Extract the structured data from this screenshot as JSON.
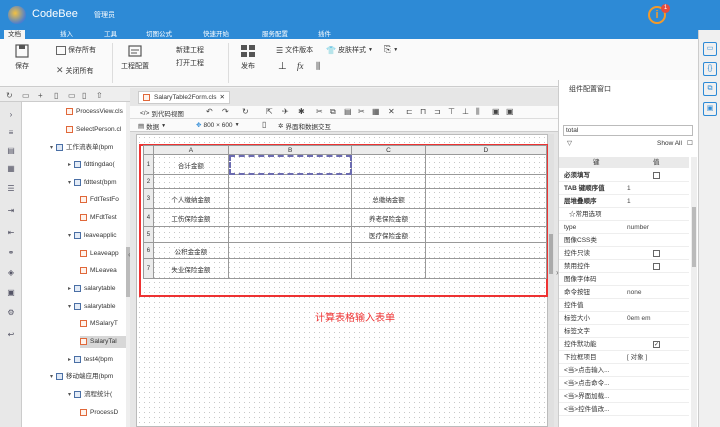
{
  "app": {
    "name": "CodeBee",
    "user": "管理员",
    "notification_count": "1"
  },
  "menu": [
    {
      "label": "文档",
      "active": true
    },
    {
      "label": "插入"
    },
    {
      "label": "工具"
    },
    {
      "label": "切图公式"
    },
    {
      "label": "快速开始"
    },
    {
      "label": "服务配置"
    },
    {
      "label": "插件"
    }
  ],
  "ribbon": {
    "save": "保存",
    "save_all": "保存所有",
    "close_all": "关闭所有",
    "project_config": "工程配置",
    "new_project": "新建工程",
    "open_project": "打开工程",
    "publish": "发布",
    "file_version": "文件版本",
    "skin_style": "皮肤样式"
  },
  "tree": [
    {
      "label": "ProcessView.cls",
      "type": "file"
    },
    {
      "label": "SelectPerson.cl",
      "type": "file"
    },
    {
      "label": "工作流表单(bpm",
      "type": "folder"
    },
    {
      "label": "fdttingdao(",
      "type": "table"
    },
    {
      "label": "fdttest(bpm",
      "type": "table"
    },
    {
      "label": "FdtTestFo",
      "type": "file"
    },
    {
      "label": "MFdtTest",
      "type": "file"
    },
    {
      "label": "leaveapplic",
      "type": "table"
    },
    {
      "label": "Leaveapp",
      "type": "file"
    },
    {
      "label": "MLeavea",
      "type": "file"
    },
    {
      "label": "salarytable",
      "type": "table"
    },
    {
      "label": "salarytable",
      "type": "table"
    },
    {
      "label": "MSalaryT",
      "type": "file"
    },
    {
      "label": "SalaryTal",
      "type": "file",
      "selected": true
    },
    {
      "label": "test4(bpm",
      "type": "table"
    },
    {
      "label": "移动端应用(bpm",
      "type": "folder"
    },
    {
      "label": "流程统计(",
      "type": "table"
    },
    {
      "label": "ProcessD",
      "type": "file"
    }
  ],
  "doc_tab": {
    "label": "SalaryTable2Form.cls"
  },
  "toolbar": {
    "code_view": "到代码视图",
    "data": "数据",
    "resolution": "800 × 600",
    "ui_interaction": "界面和数据交互"
  },
  "grid": {
    "columns": [
      "A",
      "B",
      "C",
      "D"
    ],
    "rows": [
      {
        "n": "1",
        "cells": [
          "合计金额",
          "",
          "",
          ""
        ]
      },
      {
        "n": "2",
        "cells": [
          "",
          "",
          "",
          ""
        ]
      },
      {
        "n": "3",
        "cells": [
          "个人缴纳金额",
          "",
          "总缴纳金额",
          ""
        ]
      },
      {
        "n": "4",
        "cells": [
          "工伤保险金额",
          "",
          "养老保险金额",
          ""
        ]
      },
      {
        "n": "5",
        "cells": [
          "",
          "",
          "医疗保险金额",
          ""
        ]
      },
      {
        "n": "6",
        "cells": [
          "公积金金额",
          "",
          "",
          ""
        ]
      },
      {
        "n": "7",
        "cells": [
          "失业保险金额",
          "",
          "",
          ""
        ]
      }
    ]
  },
  "annotation": "计算表格输入表单",
  "props": {
    "title": "组件配置窗口",
    "search_value": "total",
    "show_all": "Show All",
    "col_key": "键",
    "col_value": "值",
    "rows": [
      {
        "k": "必须填写",
        "v": "",
        "check": true,
        "bold": true
      },
      {
        "k": "TAB 键顺序值",
        "v": "1",
        "bold": true
      },
      {
        "k": "层堆叠顺序",
        "v": "1",
        "bold": true
      },
      {
        "k": "☆常用选项",
        "v": "",
        "section": true
      },
      {
        "k": "type",
        "v": "number"
      },
      {
        "k": "图像CSS类",
        "v": ""
      },
      {
        "k": "控件只读",
        "v": "",
        "check": true
      },
      {
        "k": "禁用控件",
        "v": "",
        "check": true
      },
      {
        "k": "图像字体码",
        "v": ""
      },
      {
        "k": "命令按钮",
        "v": "none"
      },
      {
        "k": "控件值",
        "v": ""
      },
      {
        "k": "标签大小",
        "v": "0em em"
      },
      {
        "k": "标签文字",
        "v": ""
      },
      {
        "k": "控件默功能",
        "v": "",
        "check": true,
        "checked": true
      },
      {
        "k": "下拉框项目",
        "v": "[ 对象 ]"
      },
      {
        "k": "<当>点击输入...",
        "v": ""
      },
      {
        "k": "<当>点击命令...",
        "v": ""
      },
      {
        "k": "<当>界面加载...",
        "v": ""
      },
      {
        "k": "<当>控件值改...",
        "v": ""
      }
    ]
  },
  "colors": {
    "brand": "#2d8ad6",
    "annotation": "#ee3333"
  }
}
